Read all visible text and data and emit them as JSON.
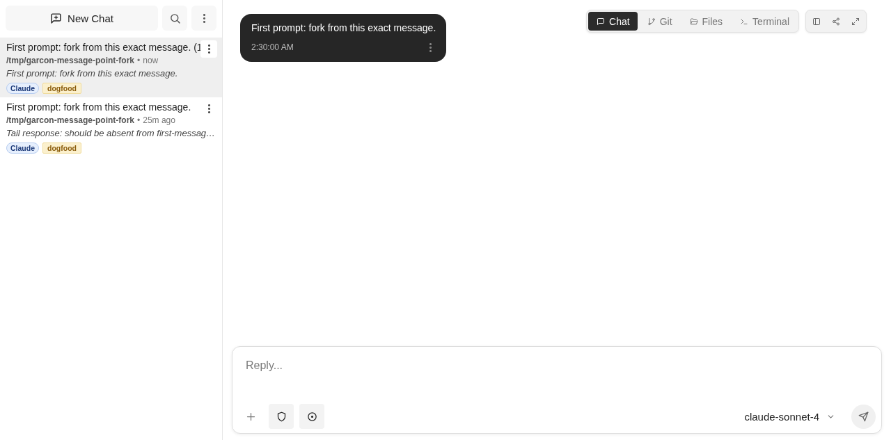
{
  "sidebar": {
    "new_chat": {
      "label": "New Chat"
    },
    "sessions": [
      {
        "title": "First prompt: fork from this exact message. (1",
        "path": "/tmp/garcon-message-point-fork",
        "separator": "•",
        "time": "now",
        "preview": "First prompt: fork from this exact message.",
        "tags": [
          {
            "label": "Claude",
            "kind": "agent"
          },
          {
            "label": "dogfood",
            "kind": "label"
          }
        ],
        "selected": true
      },
      {
        "title": "First prompt: fork from this exact message.",
        "path": "/tmp/garcon-message-point-fork",
        "separator": "•",
        "time": "25m ago",
        "preview": "Tail response: should be absent from first-messag…",
        "tags": [
          {
            "label": "Claude",
            "kind": "agent"
          },
          {
            "label": "dogfood",
            "kind": "label"
          }
        ],
        "selected": false
      }
    ]
  },
  "view_tabs": [
    {
      "label": "Chat",
      "selected": true
    },
    {
      "label": "Git",
      "selected": false
    },
    {
      "label": "Files",
      "selected": false
    },
    {
      "label": "Terminal",
      "selected": false
    }
  ],
  "messages": [
    {
      "text": "First prompt: fork from this exact message.",
      "time": "2:30:00 AM"
    }
  ],
  "composer": {
    "placeholder": "Reply...",
    "model": "claude-sonnet-4"
  }
}
